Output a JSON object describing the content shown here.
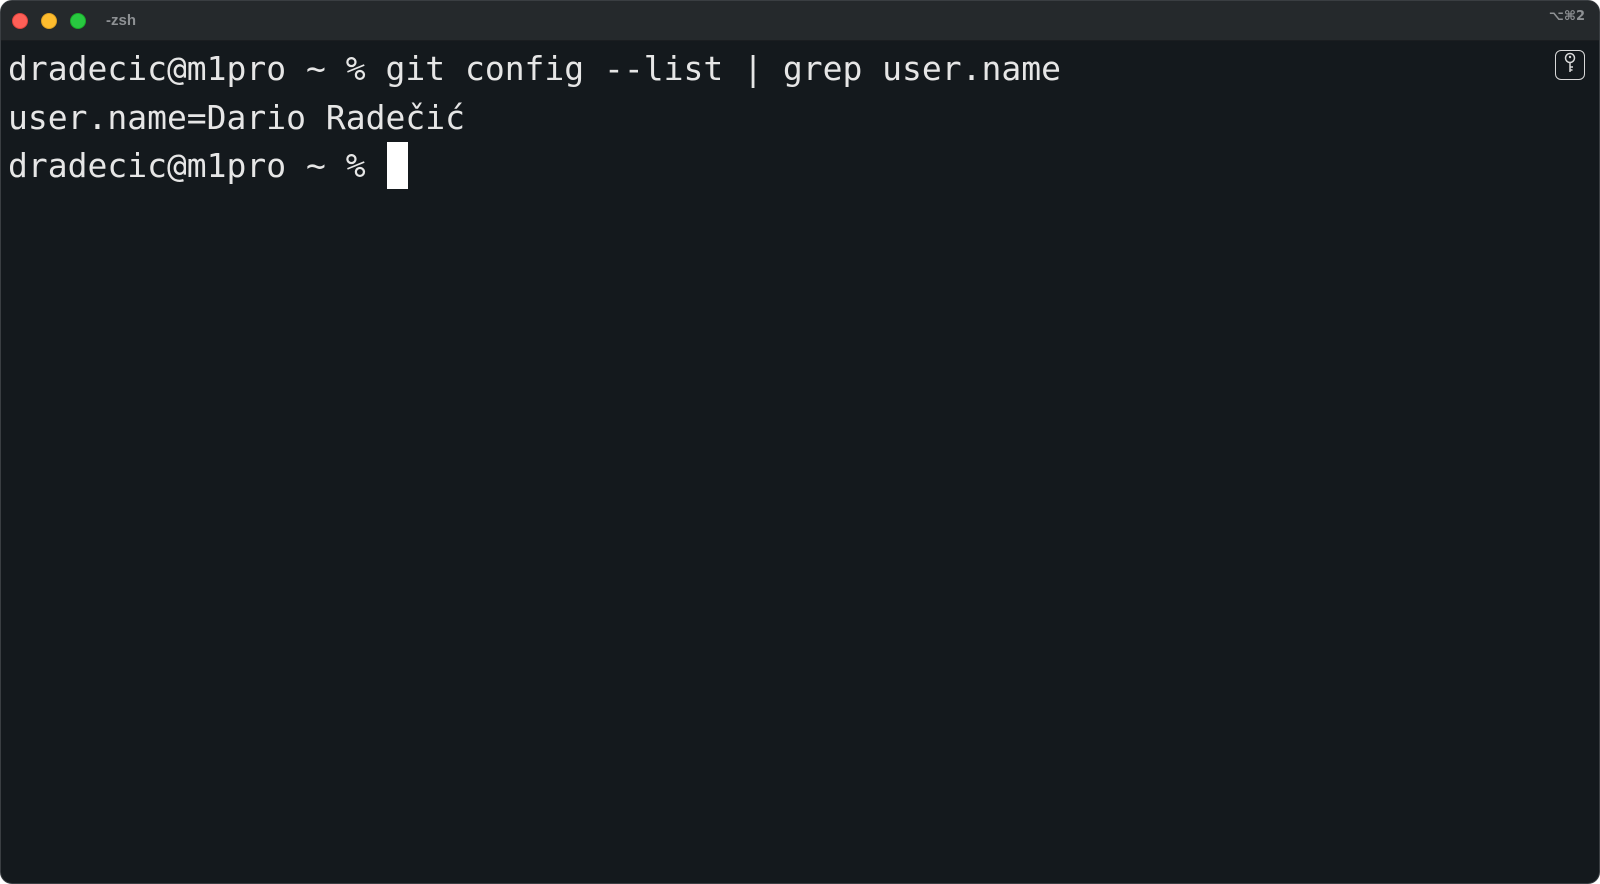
{
  "window": {
    "title": "-zsh",
    "shortcut": "⌥⌘2"
  },
  "terminal": {
    "lines": [
      "dradecic@m1pro ~ % git config --list | grep user.name",
      "user.name=Dario Radečić",
      "dradecic@m1pro ~ % "
    ]
  },
  "icons": {
    "secure_input": "key-icon"
  },
  "colors": {
    "background": "#14191d",
    "titlebar": "#25292c",
    "text": "#e6e6e6",
    "cursor": "#ffffff",
    "close": "#fe5f57",
    "minimize": "#febc2e",
    "zoom": "#28c840"
  }
}
